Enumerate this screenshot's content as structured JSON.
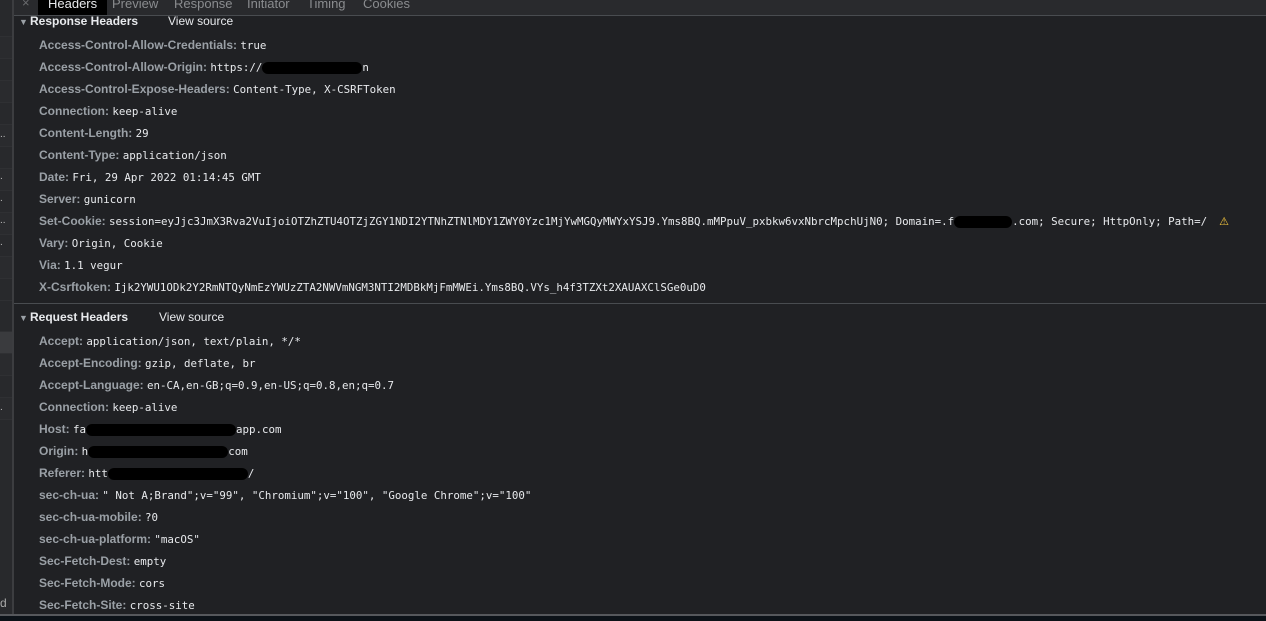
{
  "tabs": {
    "close": "×",
    "items": [
      {
        "label": "Headers",
        "active": true
      },
      {
        "label": "Preview",
        "active": false
      },
      {
        "label": "Response",
        "active": false
      },
      {
        "label": "Initiator",
        "active": false
      },
      {
        "label": "Timing",
        "active": false
      },
      {
        "label": "Cookies",
        "active": false
      }
    ]
  },
  "left_strip": {
    "dots": "..",
    "dot": ".",
    "d": "d"
  },
  "response_headers": {
    "title": "Response Headers",
    "view_source": "View source",
    "rows": [
      {
        "name": "Access-Control-Allow-Credentials:",
        "value": "true"
      },
      {
        "name": "Access-Control-Allow-Origin:",
        "value": "https://",
        "redacted_tail": "n"
      },
      {
        "name": "Access-Control-Expose-Headers:",
        "value": "Content-Type, X-CSRFToken"
      },
      {
        "name": "Connection:",
        "value": "keep-alive"
      },
      {
        "name": "Content-Length:",
        "value": "29"
      },
      {
        "name": "Content-Type:",
        "value": "application/json"
      },
      {
        "name": "Date:",
        "value": "Fri, 29 Apr 2022 01:14:45 GMT"
      },
      {
        "name": "Server:",
        "value": "gunicorn"
      },
      {
        "name": "Set-Cookie:",
        "value": "session=eyJjc3JmX3Rva2VuIjoiOTZhZTU4OTZjZGY1NDI2YTNhZTNlMDY1ZWY0Yzc1MjYwMGQyMWYxYSJ9.Yms8BQ.mMPpuV_pxbkw6vxNbrcMpchUjN0; Domain=.f",
        "redacted_tail": ".com; Secure; HttpOnly; Path=/",
        "warning": "⚠"
      },
      {
        "name": "Vary:",
        "value": "Origin, Cookie"
      },
      {
        "name": "Via:",
        "value": "1.1 vegur"
      },
      {
        "name": "X-Csrftoken:",
        "value": "Ijk2YWU1ODk2Y2RmNTQyNmEzYWUzZTA2NWVmNGM3NTI2MDBkMjFmMWEi.Yms8BQ.VYs_h4f3TZXt2XAUAXClSGe0uD0"
      }
    ]
  },
  "request_headers": {
    "title": "Request Headers",
    "view_source": "View source",
    "rows": [
      {
        "name": "Accept:",
        "value": "application/json, text/plain, */*"
      },
      {
        "name": "Accept-Encoding:",
        "value": "gzip, deflate, br"
      },
      {
        "name": "Accept-Language:",
        "value": "en-CA,en-GB;q=0.9,en-US;q=0.8,en;q=0.7"
      },
      {
        "name": "Connection:",
        "value": "keep-alive"
      },
      {
        "name": "Host:",
        "value": "fa",
        "redacted_tail": "app.com"
      },
      {
        "name": "Origin:",
        "value": "h",
        "redacted_tail": "com"
      },
      {
        "name": "Referer:",
        "value": "htt",
        "redacted_tail": "/"
      },
      {
        "name": "sec-ch-ua:",
        "value": "\" Not A;Brand\";v=\"99\", \"Chromium\";v=\"100\", \"Google Chrome\";v=\"100\""
      },
      {
        "name": "sec-ch-ua-mobile:",
        "value": "?0"
      },
      {
        "name": "sec-ch-ua-platform:",
        "value": "\"macOS\""
      },
      {
        "name": "Sec-Fetch-Dest:",
        "value": "empty"
      },
      {
        "name": "Sec-Fetch-Mode:",
        "value": "cors"
      },
      {
        "name": "Sec-Fetch-Site:",
        "value": "cross-site"
      }
    ]
  }
}
